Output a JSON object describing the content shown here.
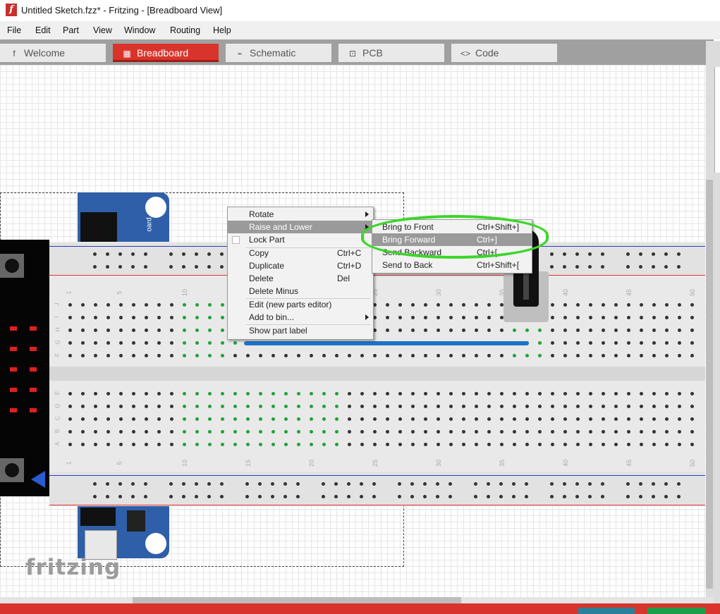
{
  "window": {
    "title": "Untitled Sketch.fzz* - Fritzing - [Breadboard View]",
    "app_icon": "f"
  },
  "menubar": {
    "items": [
      "File",
      "Edit",
      "Part",
      "View",
      "Window",
      "Routing",
      "Help"
    ]
  },
  "tabs": [
    {
      "label": "Welcome",
      "icon": "fritzing-f-icon",
      "glyph": "f",
      "active": false
    },
    {
      "label": "Breadboard",
      "icon": "breadboard-icon",
      "glyph": "▦",
      "active": true
    },
    {
      "label": "Schematic",
      "icon": "resistor-icon",
      "glyph": "⌁",
      "active": false
    },
    {
      "label": "PCB",
      "icon": "pcb-icon",
      "glyph": "⊡",
      "active": false
    },
    {
      "label": "Code",
      "icon": "code-icon",
      "glyph": "<>",
      "active": false
    }
  ],
  "module_text": "oard",
  "breadboard": {
    "column_numbers": [
      "1",
      "5",
      "10",
      "15",
      "20",
      "25",
      "30",
      "35",
      "40",
      "45",
      "50"
    ],
    "rows_top": [
      "J",
      "I",
      "H",
      "G",
      "F"
    ],
    "rows_bottom": [
      "E",
      "D",
      "C",
      "B",
      "A"
    ]
  },
  "context_menu": {
    "items": [
      {
        "label": "Rotate",
        "shortcut": "",
        "submenu": true
      },
      {
        "label": "Raise and Lower",
        "shortcut": "",
        "submenu": true,
        "highlighted": true
      },
      {
        "label": "Lock Part",
        "shortcut": "",
        "checkbox": true
      },
      {
        "label": "Copy",
        "shortcut": "Ctrl+C"
      },
      {
        "label": "Duplicate",
        "shortcut": "Ctrl+D"
      },
      {
        "label": "Delete",
        "shortcut": "Del"
      },
      {
        "label": "Delete Minus",
        "shortcut": ""
      },
      {
        "label": "Edit (new parts editor)",
        "shortcut": ""
      },
      {
        "label": "Add to bin...",
        "shortcut": "",
        "submenu": true
      },
      {
        "label": "Show part label",
        "shortcut": ""
      }
    ]
  },
  "submenu": {
    "items": [
      {
        "label": "Bring to Front",
        "shortcut": "Ctrl+Shift+]"
      },
      {
        "label": "Bring Forward",
        "shortcut": "Ctrl+]",
        "highlighted": true
      },
      {
        "label": "Send Backward",
        "shortcut": "Ctrl+["
      },
      {
        "label": "Send to Back",
        "shortcut": "Ctrl+Shift+["
      }
    ]
  },
  "watermark": "fritzing",
  "colors": {
    "accent": "#d9342b",
    "annotation_ring": "#3cd62a",
    "wire": "#1e73c8",
    "connected_hole": "#1fa33a"
  }
}
